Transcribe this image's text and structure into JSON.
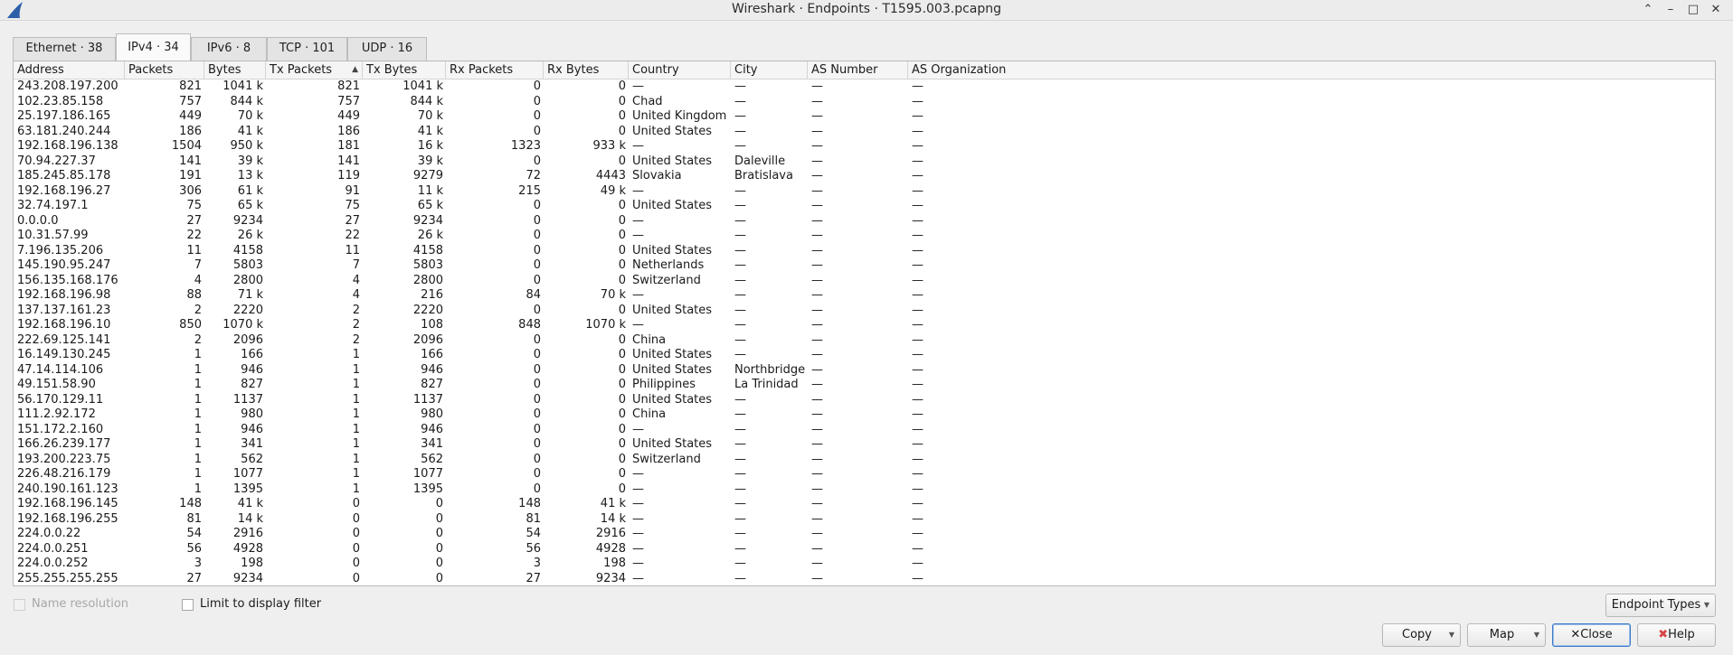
{
  "window": {
    "title": "Wireshark · Endpoints · T1595.003.pcapng"
  },
  "tabs": [
    {
      "label": "Ethernet · 38"
    },
    {
      "label": "IPv4 · 34"
    },
    {
      "label": "IPv6 · 8"
    },
    {
      "label": "TCP · 101"
    },
    {
      "label": "UDP · 16"
    }
  ],
  "table": {
    "columns": [
      "Address",
      "Packets",
      "Bytes",
      "Tx Packets",
      "Tx Bytes",
      "Rx Packets",
      "Rx Bytes",
      "Country",
      "City",
      "AS Number",
      "AS Organization"
    ],
    "sorted_column": "Tx Packets",
    "rows": [
      [
        "243.208.197.200",
        "821",
        "1041 k",
        "821",
        "1041 k",
        "0",
        "0",
        "—",
        "—",
        "—",
        "—"
      ],
      [
        "102.23.85.158",
        "757",
        "844 k",
        "757",
        "844 k",
        "0",
        "0",
        "Chad",
        "—",
        "—",
        "—"
      ],
      [
        "25.197.186.165",
        "449",
        "70 k",
        "449",
        "70 k",
        "0",
        "0",
        "United Kingdom",
        "—",
        "—",
        "—"
      ],
      [
        "63.181.240.244",
        "186",
        "41 k",
        "186",
        "41 k",
        "0",
        "0",
        "United States",
        "—",
        "—",
        "—"
      ],
      [
        "192.168.196.138",
        "1504",
        "950 k",
        "181",
        "16 k",
        "1323",
        "933 k",
        "—",
        "—",
        "—",
        "—"
      ],
      [
        "70.94.227.37",
        "141",
        "39 k",
        "141",
        "39 k",
        "0",
        "0",
        "United States",
        "Daleville",
        "—",
        "—"
      ],
      [
        "185.245.85.178",
        "191",
        "13 k",
        "119",
        "9279",
        "72",
        "4443",
        "Slovakia",
        "Bratislava",
        "—",
        "—"
      ],
      [
        "192.168.196.27",
        "306",
        "61 k",
        "91",
        "11 k",
        "215",
        "49 k",
        "—",
        "—",
        "—",
        "—"
      ],
      [
        "32.74.197.1",
        "75",
        "65 k",
        "75",
        "65 k",
        "0",
        "0",
        "United States",
        "—",
        "—",
        "—"
      ],
      [
        "0.0.0.0",
        "27",
        "9234",
        "27",
        "9234",
        "0",
        "0",
        "—",
        "—",
        "—",
        "—"
      ],
      [
        "10.31.57.99",
        "22",
        "26 k",
        "22",
        "26 k",
        "0",
        "0",
        "—",
        "—",
        "—",
        "—"
      ],
      [
        "7.196.135.206",
        "11",
        "4158",
        "11",
        "4158",
        "0",
        "0",
        "United States",
        "—",
        "—",
        "—"
      ],
      [
        "145.190.95.247",
        "7",
        "5803",
        "7",
        "5803",
        "0",
        "0",
        "Netherlands",
        "—",
        "—",
        "—"
      ],
      [
        "156.135.168.176",
        "4",
        "2800",
        "4",
        "2800",
        "0",
        "0",
        "Switzerland",
        "—",
        "—",
        "—"
      ],
      [
        "192.168.196.98",
        "88",
        "71 k",
        "4",
        "216",
        "84",
        "70 k",
        "—",
        "—",
        "—",
        "—"
      ],
      [
        "137.137.161.23",
        "2",
        "2220",
        "2",
        "2220",
        "0",
        "0",
        "United States",
        "—",
        "—",
        "—"
      ],
      [
        "192.168.196.10",
        "850",
        "1070 k",
        "2",
        "108",
        "848",
        "1070 k",
        "—",
        "—",
        "—",
        "—"
      ],
      [
        "222.69.125.141",
        "2",
        "2096",
        "2",
        "2096",
        "0",
        "0",
        "China",
        "—",
        "—",
        "—"
      ],
      [
        "16.149.130.245",
        "1",
        "166",
        "1",
        "166",
        "0",
        "0",
        "United States",
        "—",
        "—",
        "—"
      ],
      [
        "47.14.114.106",
        "1",
        "946",
        "1",
        "946",
        "0",
        "0",
        "United States",
        "Northbridge",
        "—",
        "—"
      ],
      [
        "49.151.58.90",
        "1",
        "827",
        "1",
        "827",
        "0",
        "0",
        "Philippines",
        "La Trinidad",
        "—",
        "—"
      ],
      [
        "56.170.129.11",
        "1",
        "1137",
        "1",
        "1137",
        "0",
        "0",
        "United States",
        "—",
        "—",
        "—"
      ],
      [
        "111.2.92.172",
        "1",
        "980",
        "1",
        "980",
        "0",
        "0",
        "China",
        "—",
        "—",
        "—"
      ],
      [
        "151.172.2.160",
        "1",
        "946",
        "1",
        "946",
        "0",
        "0",
        "—",
        "—",
        "—",
        "—"
      ],
      [
        "166.26.239.177",
        "1",
        "341",
        "1",
        "341",
        "0",
        "0",
        "United States",
        "—",
        "—",
        "—"
      ],
      [
        "193.200.223.75",
        "1",
        "562",
        "1",
        "562",
        "0",
        "0",
        "Switzerland",
        "—",
        "—",
        "—"
      ],
      [
        "226.48.216.179",
        "1",
        "1077",
        "1",
        "1077",
        "0",
        "0",
        "—",
        "—",
        "—",
        "—"
      ],
      [
        "240.190.161.123",
        "1",
        "1395",
        "1",
        "1395",
        "0",
        "0",
        "—",
        "—",
        "—",
        "—"
      ],
      [
        "192.168.196.145",
        "148",
        "41 k",
        "0",
        "0",
        "148",
        "41 k",
        "—",
        "—",
        "—",
        "—"
      ],
      [
        "192.168.196.255",
        "81",
        "14 k",
        "0",
        "0",
        "81",
        "14 k",
        "—",
        "—",
        "—",
        "—"
      ],
      [
        "224.0.0.22",
        "54",
        "2916",
        "0",
        "0",
        "54",
        "2916",
        "—",
        "—",
        "—",
        "—"
      ],
      [
        "224.0.0.251",
        "56",
        "4928",
        "0",
        "0",
        "56",
        "4928",
        "—",
        "—",
        "—",
        "—"
      ],
      [
        "224.0.0.252",
        "3",
        "198",
        "0",
        "0",
        "3",
        "198",
        "—",
        "—",
        "—",
        "—"
      ],
      [
        "255.255.255.255",
        "27",
        "9234",
        "0",
        "0",
        "27",
        "9234",
        "—",
        "—",
        "—",
        "—"
      ]
    ]
  },
  "options": {
    "name_resolution": "Name resolution",
    "limit_filter": "Limit to display filter"
  },
  "buttons": {
    "endpoint_types": "Endpoint Types",
    "copy": "Copy",
    "map": "Map",
    "close": "Close",
    "help": "Help"
  },
  "titlebar_icons": [
    "chevron-up-icon",
    "minimize-icon",
    "maximize-icon",
    "close-icon"
  ],
  "colors": {
    "accent": "#3b78c8",
    "app_icon": "#2c5fa8",
    "close_icon": "#d64545"
  }
}
